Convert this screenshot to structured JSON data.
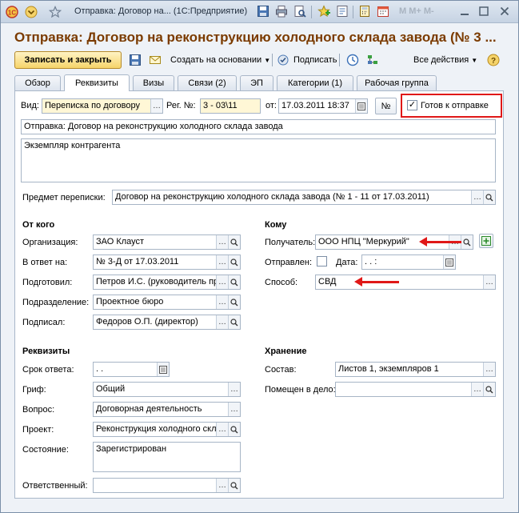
{
  "window": {
    "title": "Отправка: Договор на... (1С:Предприятие)",
    "letters": "M  M+  M-"
  },
  "form": {
    "title": "Отправка: Договор на реконструкцию холодного склада завода (№ 3 ..."
  },
  "commands": {
    "save_close": "Записать и закрыть",
    "create_based": "Создать на основании",
    "sign": "Подписать",
    "all_actions": "Все действия"
  },
  "tabs": [
    {
      "label": "Обзор"
    },
    {
      "label": "Реквизиты"
    },
    {
      "label": "Визы"
    },
    {
      "label": "Связи (2)"
    },
    {
      "label": "ЭП"
    },
    {
      "label": "Категории (1)"
    },
    {
      "label": "Рабочая группа"
    }
  ],
  "header": {
    "kind_label": "Вид:",
    "kind_value": "Переписка по договору",
    "reg_label": "Рег. №:",
    "reg_value": "3 - 03\\11",
    "from_label": "от:",
    "date_value": "17.03.2011 18:37",
    "number_btn": "№",
    "ready_label": "Готов к отправке",
    "ready_checked": true
  },
  "subject": "Отправка: Договор на реконструкцию холодного склада завода",
  "comment": "Экземпляр контрагента",
  "correspondence": {
    "label": "Предмет переписки:",
    "value": "Договор на реконструкцию холодного склада завода (№ 1 - 11 от 17.03.2011)"
  },
  "from": {
    "title": "От кого",
    "org_label": "Организация:",
    "org_value": "ЗАО Клауст",
    "reply_label": "В ответ на:",
    "reply_value": "№ 3-Д от 17.03.2011",
    "prepared_label": "Подготовил:",
    "prepared_value": "Петров И.С. (руководитель прое",
    "dept_label": "Подразделение:",
    "dept_value": "Проектное бюро",
    "signed_label": "Подписал:",
    "signed_value": "Федоров О.П. (директор)"
  },
  "to": {
    "title": "Кому",
    "recipient_label": "Получатель:",
    "recipient_value": "ООО НПЦ \"Меркурий\"",
    "sent_label": "Отправлен:",
    "date_label": "Дата:",
    "date_value": ".  .      :",
    "method_label": "Способ:",
    "method_value": "СВД"
  },
  "requisites": {
    "title": "Реквизиты",
    "deadline_label": "Срок ответа:",
    "deadline_value": ".  .",
    "stamp_label": "Гриф:",
    "stamp_value": "Общий",
    "question_label": "Вопрос:",
    "question_value": "Договорная деятельность",
    "project_label": "Проект:",
    "project_value": "Реконструкция холодного склад",
    "state_label": "Состояние:",
    "state_value": "Зарегистрирован",
    "responsible_label": "Ответственный:",
    "responsible_value": ""
  },
  "storage": {
    "title": "Хранение",
    "content_label": "Состав:",
    "content_value": "Листов 1, экземпляров 1",
    "placed_label": "Помещен в дело:",
    "placed_value": ""
  },
  "colors": {
    "title": "#7b3b00",
    "highlight": "#e01818"
  }
}
